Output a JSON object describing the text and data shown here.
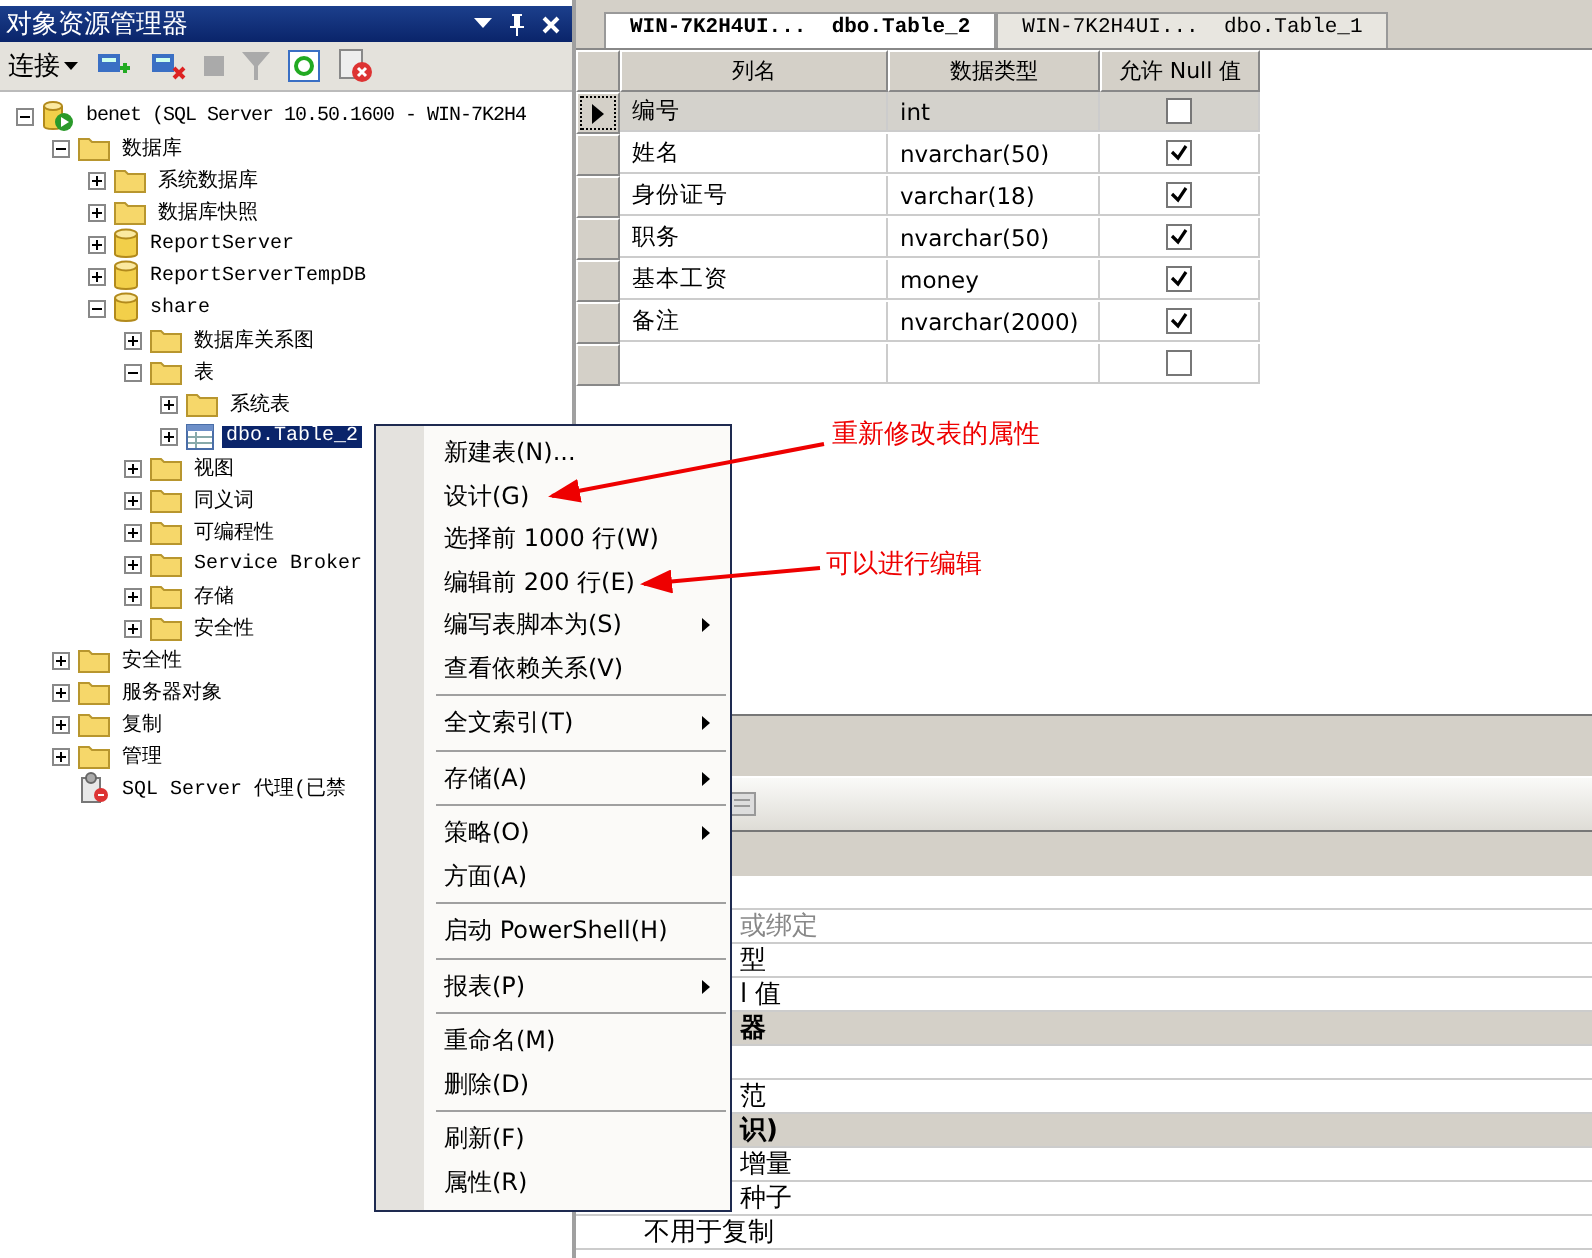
{
  "explorer": {
    "title": "对象资源管理器",
    "connect_label": "连接",
    "tree": [
      {
        "label": "benet (SQL Server 10.50.1600 - WIN-7K2H4",
        "kind": "server",
        "expanded": true,
        "selected": false,
        "children": [
          {
            "label": "数据库",
            "kind": "folder",
            "expanded": true,
            "selected": false,
            "children": [
              {
                "label": "系统数据库",
                "kind": "folder",
                "expanded": false,
                "selected": false
              },
              {
                "label": "数据库快照",
                "kind": "folder",
                "expanded": false,
                "selected": false
              },
              {
                "label": "ReportServer",
                "kind": "database",
                "expanded": false,
                "selected": false
              },
              {
                "label": "ReportServerTempDB",
                "kind": "database",
                "expanded": false,
                "selected": false
              },
              {
                "label": "share",
                "kind": "database",
                "expanded": true,
                "selected": false,
                "children": [
                  {
                    "label": "数据库关系图",
                    "kind": "folder",
                    "expanded": false,
                    "selected": false
                  },
                  {
                    "label": "表",
                    "kind": "folder",
                    "expanded": true,
                    "selected": false,
                    "children": [
                      {
                        "label": "系统表",
                        "kind": "folder",
                        "expanded": false,
                        "selected": false
                      },
                      {
                        "label": "dbo.Table_2",
                        "kind": "table",
                        "expanded": false,
                        "selected": true
                      }
                    ]
                  },
                  {
                    "label": "视图",
                    "kind": "folder",
                    "expanded": false,
                    "selected": false
                  },
                  {
                    "label": "同义词",
                    "kind": "folder",
                    "expanded": false,
                    "selected": false
                  },
                  {
                    "label": "可编程性",
                    "kind": "folder",
                    "expanded": false,
                    "selected": false
                  },
                  {
                    "label": "Service Broker",
                    "kind": "folder",
                    "expanded": false,
                    "selected": false
                  },
                  {
                    "label": "存储",
                    "kind": "folder",
                    "expanded": false,
                    "selected": false
                  },
                  {
                    "label": "安全性",
                    "kind": "folder",
                    "expanded": false,
                    "selected": false
                  }
                ]
              }
            ]
          },
          {
            "label": "安全性",
            "kind": "folder",
            "expanded": false,
            "selected": false
          },
          {
            "label": "服务器对象",
            "kind": "folder",
            "expanded": false,
            "selected": false
          },
          {
            "label": "复制",
            "kind": "folder",
            "expanded": false,
            "selected": false
          },
          {
            "label": "管理",
            "kind": "folder",
            "expanded": false,
            "selected": false
          },
          {
            "label": "SQL Server 代理(已禁",
            "kind": "agent",
            "selected": false
          }
        ]
      }
    ]
  },
  "tabs": [
    {
      "label": "WIN-7K2H4UI...  dbo.Table_2",
      "selected": true
    },
    {
      "label": "WIN-7K2H4UI...  dbo.Table_1",
      "selected": false
    }
  ],
  "table": {
    "columns": [
      "列名",
      "数据类型",
      "允许 Null 值"
    ],
    "rows": [
      {
        "name": "编号",
        "type": "int",
        "allow_null": false,
        "selected": true
      },
      {
        "name": "姓名",
        "type": "nvarchar(50)",
        "allow_null": true,
        "selected": false
      },
      {
        "name": "身份证号",
        "type": "varchar(18)",
        "allow_null": true,
        "selected": false
      },
      {
        "name": "职务",
        "type": "nvarchar(50)",
        "allow_null": true,
        "selected": false
      },
      {
        "name": "基本工资",
        "type": "money",
        "allow_null": true,
        "selected": false
      },
      {
        "name": "备注",
        "type": "nvarchar(2000)",
        "allow_null": true,
        "selected": false
      },
      {
        "allow_null": false,
        "selected": false
      }
    ]
  },
  "properties": [
    {
      "kind": "property"
    },
    {
      "kind": "property",
      "label": "或绑定",
      "covered": true,
      "disabled": true
    },
    {
      "kind": "property",
      "label": "型",
      "covered": true,
      "disabled": false
    },
    {
      "kind": "property",
      "label": "l 值",
      "covered": true,
      "disabled": false
    },
    {
      "kind": "category",
      "label": "器",
      "covered": true
    },
    {
      "kind": "property"
    },
    {
      "kind": "property",
      "label": "范",
      "covered": true,
      "disabled": false
    },
    {
      "kind": "category",
      "label": "识)",
      "covered": true
    },
    {
      "kind": "property",
      "label": "增量",
      "covered": true,
      "disabled": false
    },
    {
      "kind": "property",
      "label": "种子",
      "covered": true,
      "disabled": false
    },
    {
      "kind": "property",
      "label": "不用于复制",
      "disabled": false
    }
  ],
  "context_menu": [
    {
      "kind": "item",
      "label": "新建表(N)...",
      "submenu": false
    },
    {
      "kind": "item",
      "label": "设计(G)",
      "submenu": false
    },
    {
      "kind": "item",
      "label": "选择前 1000 行(W)",
      "submenu": false
    },
    {
      "kind": "item",
      "label": "编辑前 200 行(E)",
      "submenu": false
    },
    {
      "kind": "item",
      "label": "编写表脚本为(S)",
      "submenu": true
    },
    {
      "kind": "item",
      "label": "查看依赖关系(V)",
      "submenu": false
    },
    {
      "kind": "separator"
    },
    {
      "kind": "item",
      "label": "全文索引(T)",
      "submenu": true
    },
    {
      "kind": "separator"
    },
    {
      "kind": "item",
      "label": "存储(A)",
      "submenu": true
    },
    {
      "kind": "separator"
    },
    {
      "kind": "item",
      "label": "策略(O)",
      "submenu": true
    },
    {
      "kind": "item",
      "label": "方面(A)",
      "submenu": false
    },
    {
      "kind": "separator"
    },
    {
      "kind": "item",
      "label": "启动 PowerShell(H)",
      "submenu": false
    },
    {
      "kind": "separator"
    },
    {
      "kind": "item",
      "label": "报表(P)",
      "submenu": true
    },
    {
      "kind": "separator"
    },
    {
      "kind": "item",
      "label": "重命名(M)",
      "submenu": false
    },
    {
      "kind": "item",
      "label": "删除(D)",
      "submenu": false
    },
    {
      "kind": "separator"
    },
    {
      "kind": "item",
      "label": "刷新(F)",
      "submenu": false
    },
    {
      "kind": "item",
      "label": "属性(R)",
      "submenu": false
    }
  ],
  "annotations": [
    {
      "text": "重新修改表的属性"
    },
    {
      "text": "可以进行编辑"
    }
  ]
}
